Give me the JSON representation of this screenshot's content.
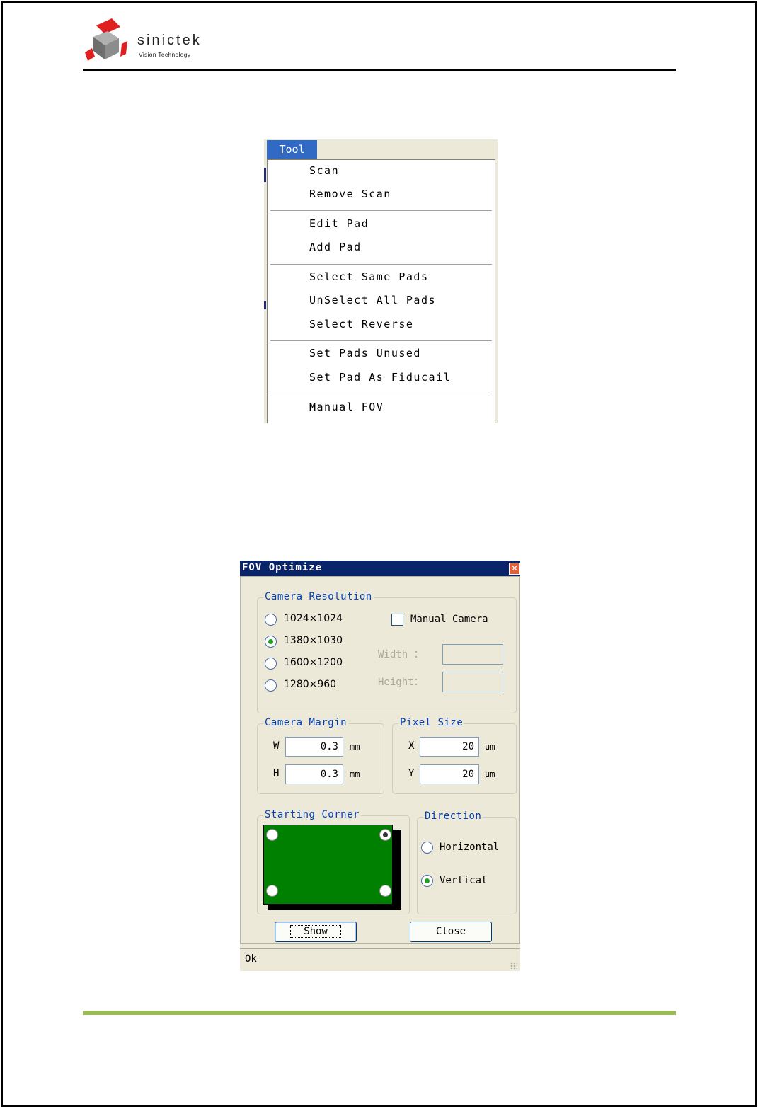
{
  "header": {
    "logo": {
      "brand": "sinictek",
      "tagline": "Vision Technology",
      "colors": {
        "accent": "#e02020",
        "cube_gray": "#8c8c8c"
      }
    }
  },
  "tool_menu": {
    "title": "Tool",
    "title_accelerator": "T",
    "title_rest": "ool",
    "items": [
      {
        "label": "Scan"
      },
      {
        "label": "Remove Scan"
      },
      {
        "label": "Edit Pad"
      },
      {
        "label": "Add Pad"
      },
      {
        "label": "Select Same Pads"
      },
      {
        "label": "UnSelect All Pads"
      },
      {
        "label": "Select Reverse"
      },
      {
        "label": "Set Pads Unused"
      },
      {
        "label": "Set Pad As Fiducail"
      },
      {
        "label": "Manual FOV"
      }
    ],
    "colors": {
      "highlight": "#316ac5"
    }
  },
  "fov_dialog": {
    "title": "FOV Optimize",
    "camera_resolution": {
      "legend": "Camera Resolution",
      "options": [
        {
          "label": "1024×1024",
          "checked": false
        },
        {
          "label": "1380×1030",
          "checked": true
        },
        {
          "label": "1600×1200",
          "checked": false
        },
        {
          "label": "1280×960",
          "checked": false
        }
      ],
      "manual_camera": {
        "label": "Manual Camera",
        "checked": false
      },
      "width_label": "Width ：",
      "height_label": "Height：",
      "width_value": "",
      "height_value": ""
    },
    "camera_margin": {
      "legend": "Camera Margin",
      "w_label": "W",
      "w_value": "0.3",
      "h_label": "H",
      "h_value": "0.3",
      "unit": "mm"
    },
    "pixel_size": {
      "legend": "Pixel Size",
      "x_label": "X",
      "x_value": "20",
      "y_label": "Y",
      "y_value": "20",
      "unit": "um"
    },
    "starting_corner": {
      "legend": "Starting Corner",
      "selected": "top-right",
      "colors": {
        "board": "#008000"
      }
    },
    "direction": {
      "legend": "Direction",
      "options": [
        {
          "label": "Horizontal",
          "checked": false
        },
        {
          "label": "Vertical",
          "checked": true
        }
      ]
    },
    "buttons": {
      "show": "Show",
      "close": "Close"
    },
    "status": "Ok"
  },
  "footer": {
    "colors": {
      "rule": "#9bbb59"
    }
  }
}
